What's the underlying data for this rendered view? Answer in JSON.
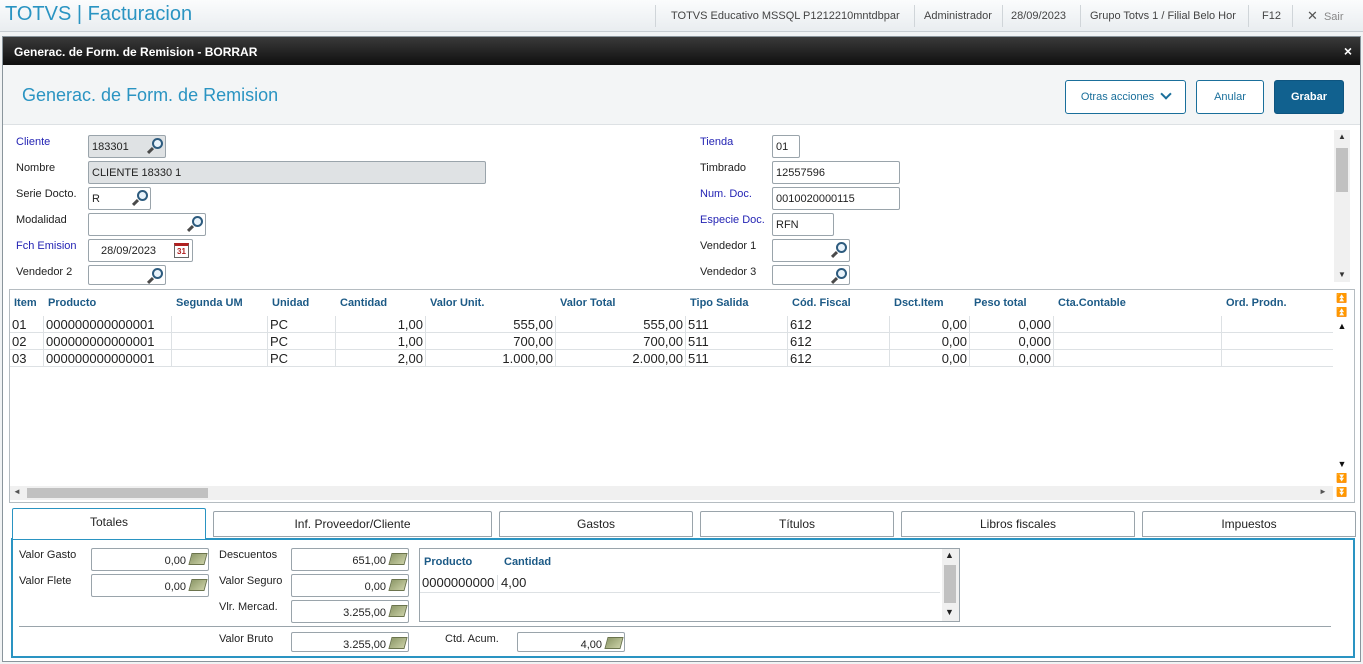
{
  "app": {
    "title": "TOTVS | Facturacion",
    "environment": "TOTVS Educativo MSSQL P1212210mntdbpar",
    "user": "Administrador",
    "date": "28/09/2023",
    "branch": "Grupo Totvs 1 / Filial Belo Hor",
    "shortcut": "F12",
    "exit_label": "Sair"
  },
  "dialog": {
    "title": "Generac. de Form. de Remision - BORRAR",
    "heading": "Generac. de Form. de Remision",
    "close": "×",
    "buttons": {
      "other_actions": "Otras acciones",
      "cancel": "Anular",
      "save": "Grabar"
    }
  },
  "form": {
    "cliente": {
      "label": "Cliente",
      "value": "183301"
    },
    "nombre": {
      "label": "Nombre",
      "value": "CLIENTE 18330 1"
    },
    "serie": {
      "label": "Serie Docto.",
      "value": "R"
    },
    "modalidad": {
      "label": "Modalidad",
      "value": ""
    },
    "fch_emision": {
      "label": "Fch Emision",
      "value": "28/09/2023"
    },
    "vendedor2": {
      "label": "Vendedor 2",
      "value": ""
    },
    "tienda": {
      "label": "Tienda",
      "value": "01"
    },
    "timbrado": {
      "label": "Timbrado",
      "value": "12557596"
    },
    "num_doc": {
      "label": "Num. Doc.",
      "value": "0010020000115"
    },
    "especie_doc": {
      "label": "Especie Doc.",
      "value": "RFN"
    },
    "vendedor1": {
      "label": "Vendedor 1",
      "value": ""
    },
    "vendedor3": {
      "label": "Vendedor 3",
      "value": ""
    }
  },
  "grid": {
    "columns": [
      "Item",
      "Producto",
      "Segunda UM",
      "Unidad",
      "Cantidad",
      "Valor Unit.",
      "Valor Total",
      "Tipo Salida",
      "Cód. Fiscal",
      "Dsct.Item",
      "Peso total",
      "Cta.Contable",
      "Ord. Prodn."
    ],
    "rows": [
      {
        "item": "01",
        "producto": "000000000000001",
        "segunda_um": "",
        "unidad": "PC",
        "cantidad": "1,00",
        "valor_unit": "555,00",
        "valor_total": "555,00",
        "tipo_salida": "511",
        "cod_fiscal": "612",
        "dsct_item": "0,00",
        "peso_total": "0,000",
        "cta_contable": "",
        "ord_prodn": ""
      },
      {
        "item": "02",
        "producto": "000000000000001",
        "segunda_um": "",
        "unidad": "PC",
        "cantidad": "1,00",
        "valor_unit": "700,00",
        "valor_total": "700,00",
        "tipo_salida": "511",
        "cod_fiscal": "612",
        "dsct_item": "0,00",
        "peso_total": "0,000",
        "cta_contable": "",
        "ord_prodn": ""
      },
      {
        "item": "03",
        "producto": "000000000000001",
        "segunda_um": "",
        "unidad": "PC",
        "cantidad": "2,00",
        "valor_unit": "1.000,00",
        "valor_total": "2.000,00",
        "tipo_salida": "511",
        "cod_fiscal": "612",
        "dsct_item": "0,00",
        "peso_total": "0,000",
        "cta_contable": "",
        "ord_prodn": ""
      }
    ]
  },
  "tabs": [
    "Totales",
    "Inf. Proveedor/Cliente",
    "Gastos",
    "Títulos",
    "Libros fiscales",
    "Impuestos"
  ],
  "totals": {
    "valor_gasto": {
      "label": "Valor Gasto",
      "value": "0,00"
    },
    "valor_flete": {
      "label": "Valor Flete",
      "value": "0,00"
    },
    "descuentos": {
      "label": "Descuentos",
      "value": "651,00"
    },
    "valor_seguro": {
      "label": "Valor Seguro",
      "value": "0,00"
    },
    "vlr_mercad": {
      "label": "Vlr. Mercad.",
      "value": "3.255,00"
    },
    "valor_bruto": {
      "label": "Valor Bruto",
      "value": "3.255,00"
    },
    "ctd_acum": {
      "label": "Ctd. Acum.",
      "value": "4,00"
    },
    "product_grid": {
      "columns": [
        "Producto",
        "Cantidad"
      ],
      "rows": [
        {
          "producto": "0000000000",
          "cantidad": "4,00"
        }
      ]
    }
  }
}
